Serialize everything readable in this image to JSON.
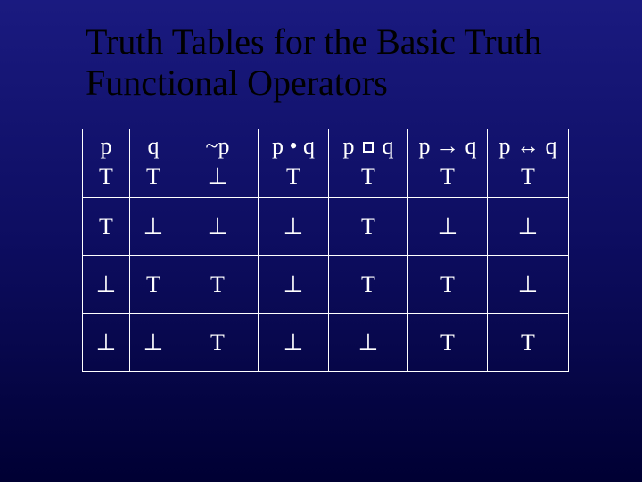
{
  "title": "Truth Tables for the Basic Truth Functional Operators",
  "sym": {
    "T": "T",
    "F": "⊥",
    "not": "~",
    "and": "•",
    "or_square": "□",
    "imp": "→",
    "bicond": "↔"
  },
  "headers": {
    "c0": "p",
    "c1": "q",
    "c2": "~p",
    "c3": "p • q",
    "c4": "p □ q",
    "c5": "p → q",
    "c6": "p ↔ q"
  },
  "chart_data": {
    "type": "table",
    "title": "Truth Tables for the Basic Truth Functional Operators",
    "columns": [
      "p",
      "q",
      "~p",
      "p AND q",
      "p OR q",
      "p -> q",
      "p <-> q"
    ],
    "rows": [
      [
        "T",
        "T",
        "F",
        "T",
        "T",
        "T",
        "T"
      ],
      [
        "T",
        "F",
        "F",
        "F",
        "T",
        "F",
        "F"
      ],
      [
        "F",
        "T",
        "T",
        "F",
        "T",
        "T",
        "F"
      ],
      [
        "F",
        "F",
        "T",
        "F",
        "F",
        "T",
        "T"
      ]
    ],
    "legend": {
      "T": "true",
      "F": "false (rendered as ⊥)"
    }
  },
  "row0": {
    "c0": "T",
    "c1": "T",
    "c2": "⊥",
    "c3": "T",
    "c4": "T",
    "c5": "T",
    "c6": "T"
  },
  "row1": {
    "c0": "T",
    "c1": "⊥",
    "c2": "⊥",
    "c3": "⊥",
    "c4": "T",
    "c5": "⊥",
    "c6": "⊥"
  },
  "row2": {
    "c0": "⊥",
    "c1": "T",
    "c2": "T",
    "c3": "⊥",
    "c4": "T",
    "c5": "T",
    "c6": "⊥"
  },
  "row3": {
    "c0": "⊥",
    "c1": "⊥",
    "c2": "T",
    "c3": "⊥",
    "c4": "⊥",
    "c5": "T",
    "c6": "T"
  }
}
